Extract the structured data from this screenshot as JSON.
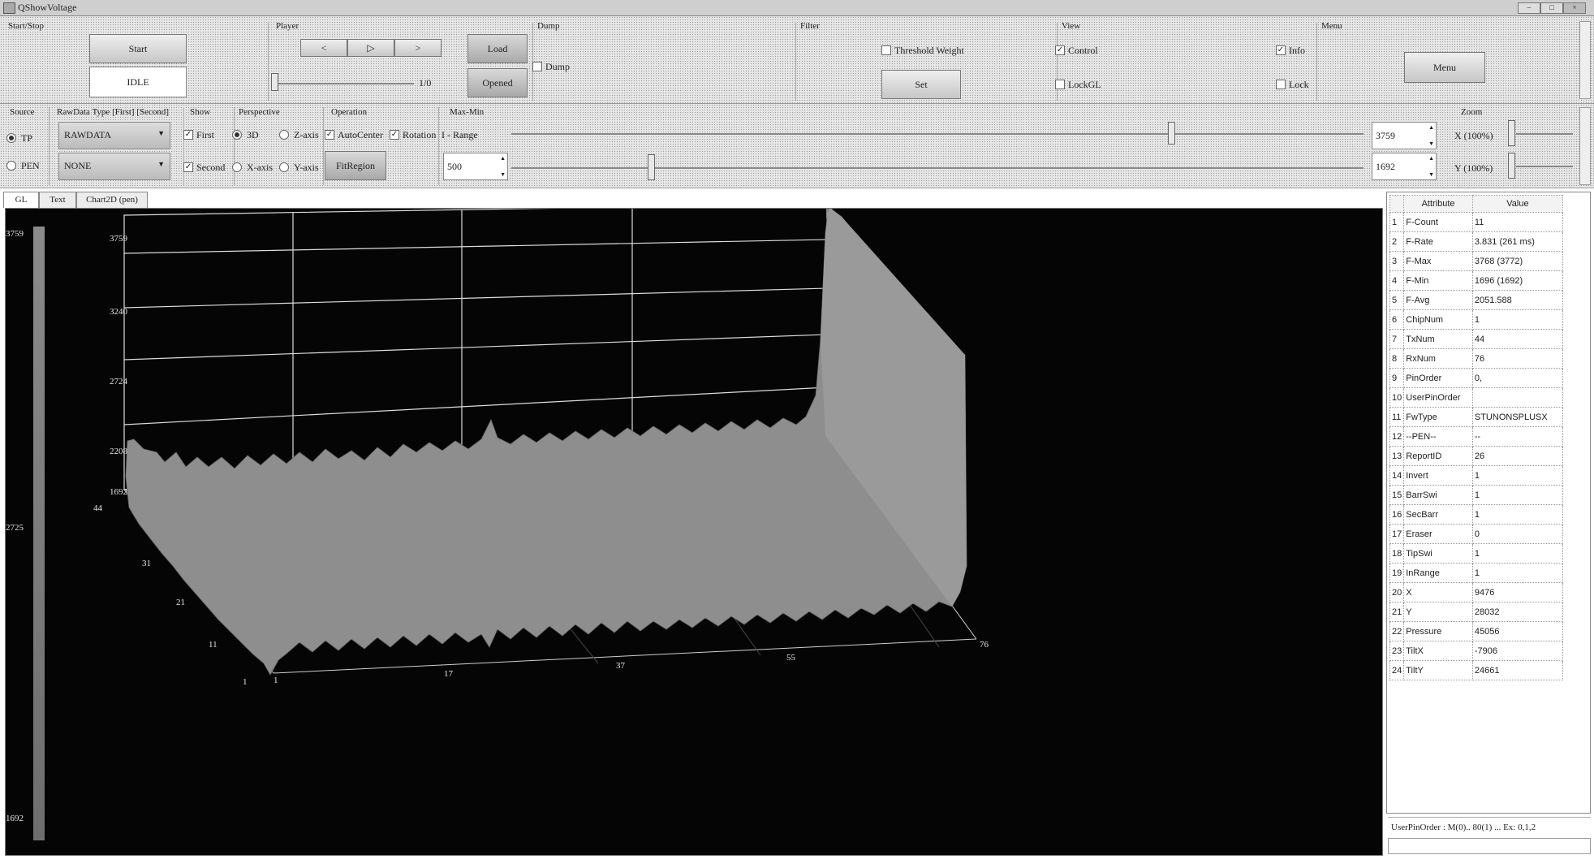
{
  "window": {
    "title": "QShowVoltage"
  },
  "groups": {
    "start_stop": "Start/Stop",
    "player": "Player",
    "dump": "Dump",
    "filter": "Filter",
    "view": "View",
    "menu": "Menu",
    "source": "Source",
    "rawdata_type": "RawData Type [First] [Second]",
    "show": "Show",
    "perspective": "Perspective",
    "operation": "Operation",
    "max_min": "Max-Min",
    "zoom": "Zoom"
  },
  "start_stop": {
    "start_label": "Start",
    "status": "IDLE"
  },
  "player": {
    "prev_label": "<",
    "play_label": "▷",
    "next_label": ">",
    "frame_counter": "1/0"
  },
  "dump": {
    "load_label": "Load",
    "opened_label": "Opened",
    "dump_label": "Dump",
    "dump_checked": false
  },
  "filter": {
    "threshold_weight_label": "Threshold Weight",
    "threshold_checked": false,
    "set_label": "Set"
  },
  "view": {
    "control_label": "Control",
    "control_checked": true,
    "info_label": "Info",
    "info_checked": true,
    "lockgl_label": "LockGL",
    "lockgl_checked": false,
    "lock_label": "Lock",
    "lock_checked": false
  },
  "menu": {
    "menu_label": "Menu"
  },
  "source": {
    "tp_label": "TP",
    "pen_label": "PEN",
    "selected": "TP"
  },
  "rawdata_type": {
    "first": "RAWDATA",
    "second": "NONE"
  },
  "show": {
    "first_label": "First",
    "first_checked": true,
    "second_label": "Second",
    "second_checked": true
  },
  "perspective": {
    "d3_label": "3D",
    "zaxis_label": "Z-axis",
    "xaxis_label": "X-axis",
    "yaxis_label": "Y-axis",
    "selected": "3D"
  },
  "operation": {
    "autocenter_label": "AutoCenter",
    "autocenter_checked": true,
    "rotation_label": "Rotation",
    "rotation_checked": true,
    "fitregion_label": "FitRegion"
  },
  "max_min": {
    "range_label": "I - Range",
    "range_value": "500",
    "max_value": "3759",
    "min_value": "1692",
    "max_slider": 0.77,
    "min_slider": 0.16
  },
  "zoom": {
    "x_label": "X (100%)",
    "y_label": "Y (100%)"
  },
  "tabs": [
    {
      "label": "GL",
      "active": true
    },
    {
      "label": "Text",
      "active": false
    },
    {
      "label": "Chart2D (pen)",
      "active": false
    }
  ],
  "gl_view": {
    "colorbar_max": "3759",
    "colorbar_mid": "2725",
    "colorbar_min": "1692",
    "z_ticks": [
      "3759",
      "3240",
      "2724",
      "2208",
      "1692"
    ],
    "y_ticks": [
      "44",
      "31",
      "21",
      "11",
      "1"
    ],
    "x_ticks": [
      "1",
      "17",
      "37",
      "55",
      "76"
    ]
  },
  "attribute_table": {
    "headers": [
      "Attribute",
      "Value"
    ],
    "rows": [
      {
        "n": "1",
        "attr": "F-Count",
        "val": "11"
      },
      {
        "n": "2",
        "attr": "F-Rate",
        "val": "3.831 (261 ms)"
      },
      {
        "n": "3",
        "attr": "F-Max",
        "val": "3768 (3772)"
      },
      {
        "n": "4",
        "attr": "F-Min",
        "val": "1696 (1692)"
      },
      {
        "n": "5",
        "attr": "F-Avg",
        "val": "2051.588"
      },
      {
        "n": "6",
        "attr": "ChipNum",
        "val": "1"
      },
      {
        "n": "7",
        "attr": "TxNum",
        "val": "44"
      },
      {
        "n": "8",
        "attr": "RxNum",
        "val": "76"
      },
      {
        "n": "9",
        "attr": "PinOrder",
        "val": "0,"
      },
      {
        "n": "10",
        "attr": "UserPinOrder",
        "val": ""
      },
      {
        "n": "11",
        "attr": "FwType",
        "val": "STUNONSPLUSX"
      },
      {
        "n": "12",
        "attr": "--PEN--",
        "val": "--"
      },
      {
        "n": "13",
        "attr": "ReportID",
        "val": "26"
      },
      {
        "n": "14",
        "attr": "Invert",
        "val": "1"
      },
      {
        "n": "15",
        "attr": "BarrSwi",
        "val": "1"
      },
      {
        "n": "16",
        "attr": "SecBarr",
        "val": "1"
      },
      {
        "n": "17",
        "attr": "Eraser",
        "val": "0"
      },
      {
        "n": "18",
        "attr": "TipSwi",
        "val": "1"
      },
      {
        "n": "19",
        "attr": "InRange",
        "val": "1"
      },
      {
        "n": "20",
        "attr": "X",
        "val": "9476"
      },
      {
        "n": "21",
        "attr": "Y",
        "val": "28032"
      },
      {
        "n": "22",
        "attr": "Pressure",
        "val": "45056"
      },
      {
        "n": "23",
        "attr": "TiltX",
        "val": "-7906"
      },
      {
        "n": "24",
        "attr": "TiltY",
        "val": "24661"
      }
    ]
  },
  "status_bar": {
    "user_pin_order_hint": "UserPinOrder : M(0).. 80(1) ... Ex: 0,1,2"
  }
}
